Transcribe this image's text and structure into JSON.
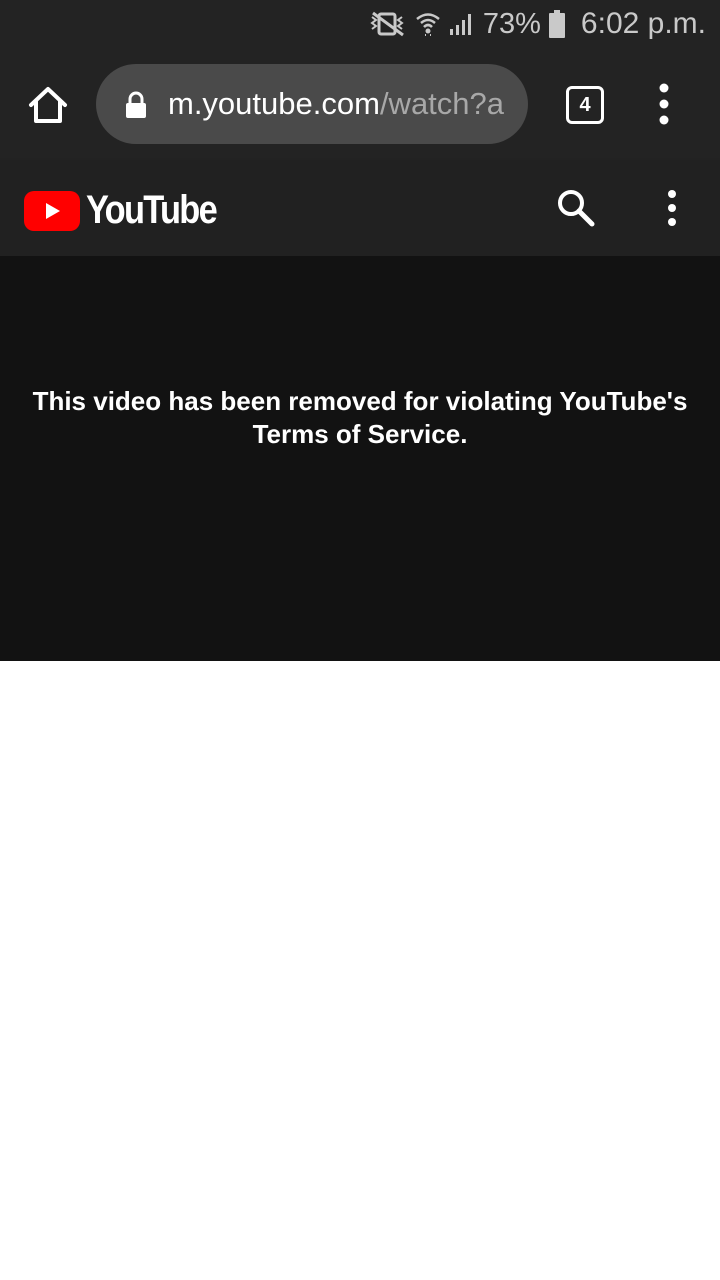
{
  "status_bar": {
    "battery_percent": "73%",
    "time": "6:02 p.m.",
    "icons": [
      "vibrate-mute-icon",
      "wifi-icon",
      "signal-icon",
      "battery-icon"
    ]
  },
  "browser": {
    "url_host": "m.youtube.com",
    "url_path": "/watch?a",
    "tab_count": "4",
    "icons": [
      "home-icon",
      "lock-icon",
      "tab-switcher-icon",
      "overflow-menu-icon"
    ]
  },
  "youtube_header": {
    "logo_text": "YouTube",
    "icons": [
      "youtube-play-icon",
      "search-icon",
      "more-vert-icon"
    ]
  },
  "player": {
    "message": "This video has been removed for violating YouTube's Terms of Service."
  },
  "colors": {
    "chrome_bg": "#232323",
    "omnibox_bg": "#4a4a4a",
    "youtube_red": "#ff0000",
    "player_bg": "#121212"
  }
}
